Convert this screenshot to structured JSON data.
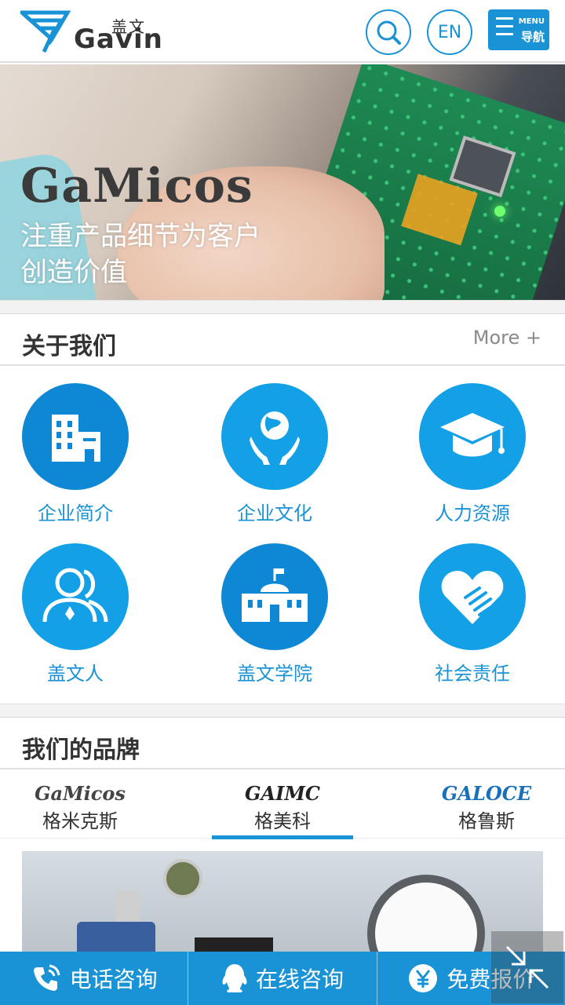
{
  "header": {
    "logo_cn": "盖文",
    "logo_en": "Gavin",
    "en_label": "EN",
    "menu_en": "MENU",
    "menu_cn": "导航"
  },
  "banner": {
    "brand": "GaMicos",
    "slogan_line1": "注重产品细节为客户",
    "slogan_line2": "创造价值",
    "slide_count": 4,
    "active_slide": 2
  },
  "about": {
    "title": "关于我们",
    "more": "More +",
    "items": [
      {
        "label": "企业简介",
        "icon": "building-icon"
      },
      {
        "label": "企业文化",
        "icon": "globe-hands-icon"
      },
      {
        "label": "人力资源",
        "icon": "graduation-cap-icon"
      },
      {
        "label": "盖文人",
        "icon": "people-icon"
      },
      {
        "label": "盖文学院",
        "icon": "school-icon"
      },
      {
        "label": "社会责任",
        "icon": "heart-hands-icon"
      }
    ]
  },
  "brands": {
    "title": "我们的品牌",
    "tabs": [
      {
        "logo": "GaMicos",
        "name": "格米克斯"
      },
      {
        "logo": "GAIMC",
        "name": "格美科"
      },
      {
        "logo": "GALOCE",
        "name": "格鲁斯"
      }
    ],
    "active_tab": 1
  },
  "bottom_bar": {
    "phone": "电话咨询",
    "online": "在线咨询",
    "quote": "免费报价"
  },
  "colors": {
    "primary": "#1a93d6",
    "icon_dark": "#0e88d4",
    "icon_light": "#13a0e6",
    "text": "#333333"
  }
}
